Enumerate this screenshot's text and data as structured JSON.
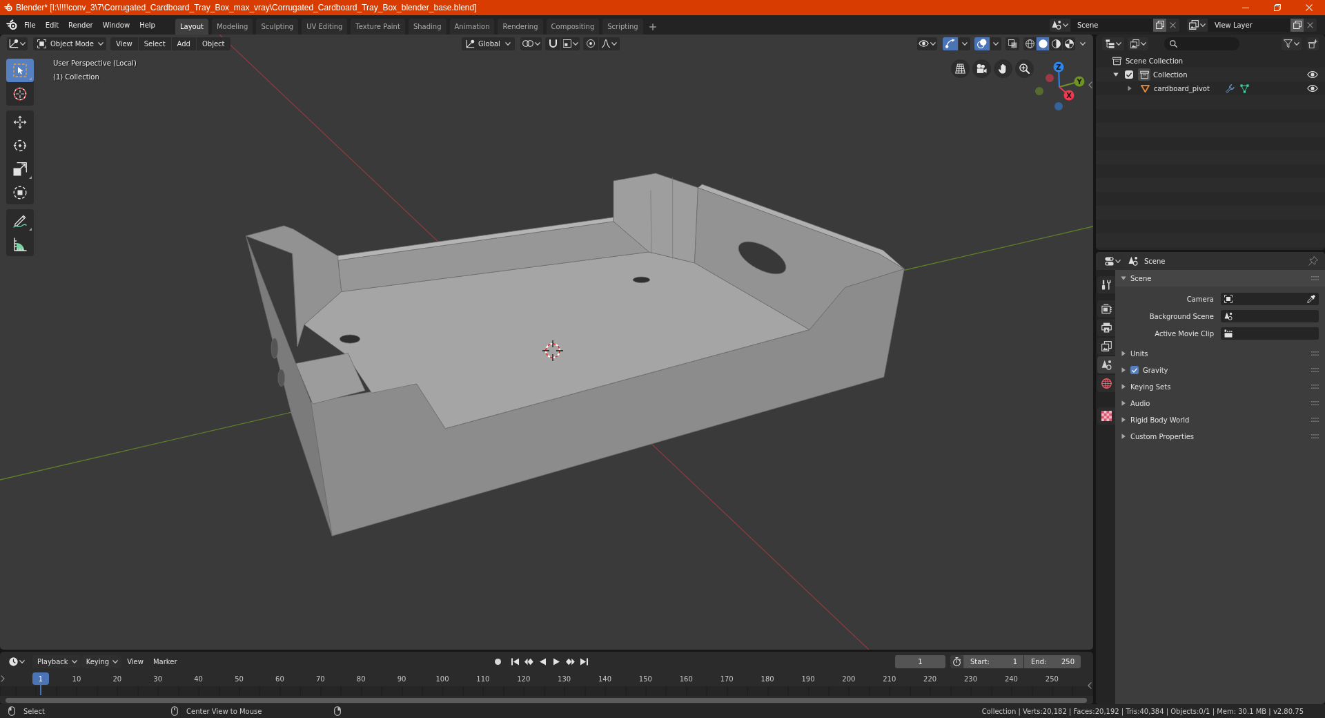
{
  "window": {
    "title": "Blender* [I:\\!!!!conv_3\\7\\Corrugated_Cardboard_Tray_Box_max_vray\\Corrugated_Cardboard_Tray_Box_blender_base.blend]"
  },
  "menu": [
    "File",
    "Edit",
    "Render",
    "Window",
    "Help"
  ],
  "workspaces": [
    {
      "label": "Layout",
      "selected": true
    },
    {
      "label": "Modeling",
      "selected": false
    },
    {
      "label": "Sculpting",
      "selected": false
    },
    {
      "label": "UV Editing",
      "selected": false
    },
    {
      "label": "Texture Paint",
      "selected": false
    },
    {
      "label": "Shading",
      "selected": false
    },
    {
      "label": "Animation",
      "selected": false
    },
    {
      "label": "Rendering",
      "selected": false
    },
    {
      "label": "Compositing",
      "selected": false
    },
    {
      "label": "Scripting",
      "selected": false
    }
  ],
  "scene": "Scene",
  "view_layer": "View Layer",
  "viewport": {
    "header": {
      "mode": "Object Mode",
      "menus": [
        "View",
        "Select",
        "Add",
        "Object"
      ],
      "orientation": "Global",
      "gizmos_on": true,
      "overlays_on": true,
      "xray_on": false,
      "shading": [
        {
          "kind": "wireframe",
          "selected": false
        },
        {
          "kind": "solid",
          "selected": true
        },
        {
          "kind": "material",
          "selected": false
        },
        {
          "kind": "rendered",
          "selected": false
        }
      ]
    },
    "info": [
      "User Perspective (Local)",
      "(1) Collection"
    ],
    "toolbar": [
      [
        {
          "kind": "select_box",
          "selected": true
        },
        {
          "kind": "cursor",
          "selected": false
        }
      ],
      [
        {
          "kind": "move",
          "selected": false
        },
        {
          "kind": "rotate",
          "selected": false
        },
        {
          "kind": "scale",
          "selected": false
        },
        {
          "kind": "transform",
          "selected": false
        }
      ],
      [
        {
          "kind": "annotate",
          "selected": false
        },
        {
          "kind": "measure",
          "selected": false
        }
      ]
    ],
    "gizmo": [
      {
        "label": "Z",
        "color": "#2f86ea"
      },
      {
        "label": "Y",
        "color": "#6f9424"
      },
      {
        "label": "X",
        "color": "#f2374f"
      }
    ]
  },
  "outliner": {
    "tree": [
      {
        "label": "Scene Collection",
        "kind": "scene_collection",
        "children": [
          {
            "label": "Collection",
            "kind": "collection",
            "expanded": true,
            "checked": true,
            "active": true,
            "visible": true,
            "children": [
              {
                "label": "cardboard_pivot",
                "kind": "mesh_object",
                "expanded": false,
                "visible": true
              }
            ]
          }
        ]
      }
    ]
  },
  "properties": {
    "context": "Scene",
    "tabs": [
      [
        {
          "kind": "tool",
          "selected": false
        }
      ],
      [
        {
          "kind": "render",
          "selected": false
        },
        {
          "kind": "output",
          "selected": false
        },
        {
          "kind": "view_layer",
          "selected": false
        },
        {
          "kind": "scene",
          "selected": true
        },
        {
          "kind": "world",
          "selected": false
        }
      ],
      [
        {
          "kind": "texture",
          "selected": false
        }
      ]
    ],
    "panels": [
      {
        "title": "Scene",
        "expanded": true,
        "fields": [
          {
            "label": "Camera",
            "kind": "object"
          },
          {
            "label": "Background Scene",
            "kind": "scene"
          },
          {
            "label": "Active Movie Clip",
            "kind": "clip"
          }
        ]
      },
      {
        "title": "Units",
        "expanded": false
      },
      {
        "title": "Gravity",
        "expanded": false,
        "checkbox": {
          "checked": true
        }
      },
      {
        "title": "Keying Sets",
        "expanded": false
      },
      {
        "title": "Audio",
        "expanded": false
      },
      {
        "title": "Rigid Body World",
        "expanded": false
      },
      {
        "title": "Custom Properties",
        "expanded": false
      }
    ]
  },
  "timeline": {
    "menus": [
      {
        "label": "Playback",
        "kind": "dropdown"
      },
      {
        "label": "Keying",
        "kind": "dropdown"
      },
      {
        "label": "View",
        "kind": "plain"
      },
      {
        "label": "Marker",
        "kind": "plain"
      }
    ],
    "current_frame": "1",
    "start": {
      "label": "Start:",
      "value": "1"
    },
    "end": {
      "label": "End:",
      "value": "250"
    },
    "playhead": "1",
    "ruler": [
      "10",
      "20",
      "30",
      "40",
      "50",
      "60",
      "70",
      "80",
      "90",
      "100",
      "110",
      "120",
      "130",
      "140",
      "150",
      "160",
      "170",
      "180",
      "190",
      "200",
      "210",
      "220",
      "230",
      "240",
      "250"
    ]
  },
  "status": {
    "hints": [
      "Select",
      "Center View to Mouse"
    ],
    "stats": "Collection | Verts:20,182 | Faces:20,192 | Tris:40,384 | Objects:0/1 | Mem: 30.1 MB | v2.80.75"
  }
}
